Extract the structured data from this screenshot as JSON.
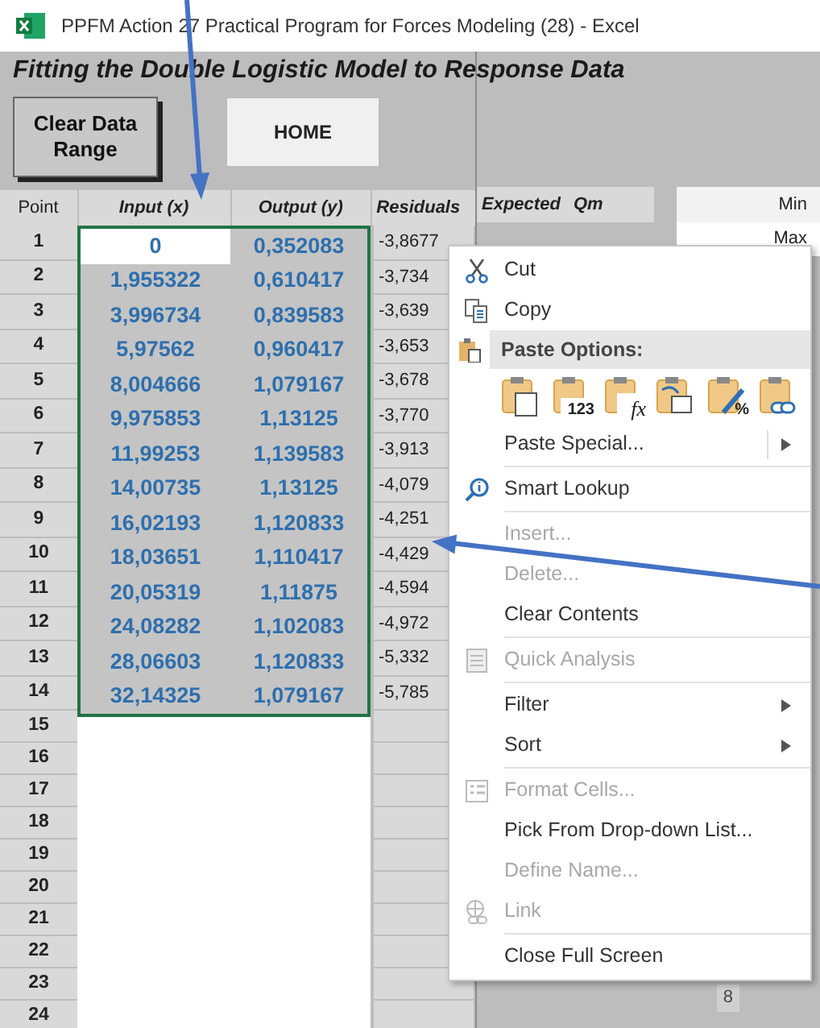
{
  "window": {
    "title": "PPFM Action 27 Practical Program for Forces Modeling (28) - Excel"
  },
  "sheet": {
    "heading": "Fitting the Double Logistic Model to  Response Data",
    "buttons": [
      {
        "label": "Clear Data Range",
        "kind": "raised"
      },
      {
        "label": "HOME",
        "kind": "flat"
      }
    ],
    "columns": [
      "Point",
      "Input (x)",
      "Output (y)",
      "Residuals",
      "Expected",
      "Qm",
      "Min"
    ],
    "rows": [
      {
        "point": "1",
        "input": "0",
        "output": "0,352083",
        "residual": "-3,8677",
        "active": true,
        "side": "Max"
      },
      {
        "point": "2",
        "input": "1,955322",
        "output": "0,610417",
        "residual": "-3,734",
        "active": false
      },
      {
        "point": "3",
        "input": "3,996734",
        "output": "0,839583",
        "residual": "-3,639",
        "active": false
      },
      {
        "point": "4",
        "input": "5,97562",
        "output": "0,960417",
        "residual": "-3,653",
        "active": false
      },
      {
        "point": "5",
        "input": "8,004666",
        "output": "1,079167",
        "residual": "-3,678",
        "active": false
      },
      {
        "point": "6",
        "input": "9,975853",
        "output": "1,13125",
        "residual": "-3,770",
        "active": false
      },
      {
        "point": "7",
        "input": "11,99253",
        "output": "1,139583",
        "residual": "-3,913",
        "active": false
      },
      {
        "point": "8",
        "input": "14,00735",
        "output": "1,13125",
        "residual": "-4,079",
        "active": false
      },
      {
        "point": "9",
        "input": "16,02193",
        "output": "1,120833",
        "residual": "-4,251",
        "active": false
      },
      {
        "point": "10",
        "input": "18,03651",
        "output": "1,110417",
        "residual": "-4,429",
        "active": false
      },
      {
        "point": "11",
        "input": "20,05319",
        "output": "1,11875",
        "residual": "-4,594",
        "active": false
      },
      {
        "point": "12",
        "input": "24,08282",
        "output": "1,102083",
        "residual": "-4,972",
        "active": false
      },
      {
        "point": "13",
        "input": "28,06603",
        "output": "1,120833",
        "residual": "-5,332",
        "active": false
      },
      {
        "point": "14",
        "input": "32,14325",
        "output": "1,079167",
        "residual": "-5,785",
        "active": false
      }
    ],
    "empty_rows": [
      "15",
      "16",
      "17",
      "18",
      "19",
      "20",
      "21",
      "22",
      "23",
      "24"
    ],
    "corner_value": "8"
  },
  "context_menu": {
    "items": [
      {
        "kind": "cut",
        "label": "Cut",
        "disabled": false
      },
      {
        "kind": "copy",
        "label": "Copy",
        "disabled": false
      },
      {
        "kind": "header",
        "label": "Paste Options:"
      },
      {
        "kind": "paste",
        "icons": [
          {
            "kind": "plain"
          },
          {
            "kind": "values",
            "label": "123"
          },
          {
            "kind": "formula",
            "label": "fx"
          },
          {
            "kind": "transpose"
          },
          {
            "kind": "format",
            "label": "%"
          },
          {
            "kind": "link"
          }
        ]
      },
      {
        "kind": "plain",
        "label": "Paste Special...",
        "disabled": false,
        "submenu": true,
        "split": true
      },
      {
        "kind": "separator"
      },
      {
        "kind": "lookup",
        "label": "Smart Lookup",
        "disabled": false
      },
      {
        "kind": "separator"
      },
      {
        "kind": "plain",
        "label": "Insert...",
        "disabled": true
      },
      {
        "kind": "plain",
        "label": "Delete...",
        "disabled": true
      },
      {
        "kind": "plain",
        "label": "Clear Contents",
        "disabled": false
      },
      {
        "kind": "separator"
      },
      {
        "kind": "analysis",
        "label": "Quick Analysis",
        "disabled": true
      },
      {
        "kind": "separator"
      },
      {
        "kind": "plain",
        "label": "Filter",
        "disabled": false,
        "submenu": true
      },
      {
        "kind": "plain",
        "label": "Sort",
        "disabled": false,
        "submenu": true
      },
      {
        "kind": "separator"
      },
      {
        "kind": "format",
        "label": "Format Cells...",
        "disabled": true
      },
      {
        "kind": "plain",
        "label": "Pick From Drop-down List...",
        "disabled": false
      },
      {
        "kind": "plain",
        "label": "Define Name...",
        "disabled": true
      },
      {
        "kind": "link",
        "label": "Link",
        "disabled": true
      },
      {
        "kind": "separator"
      },
      {
        "kind": "plain",
        "label": "Close Full Screen",
        "disabled": false
      }
    ]
  }
}
